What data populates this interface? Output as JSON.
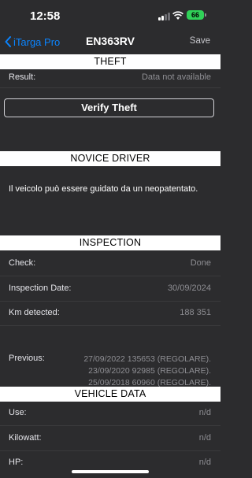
{
  "status": {
    "time": "12:58",
    "battery": "66"
  },
  "nav": {
    "back_label": "iTarga Pro",
    "title": "EN363RV",
    "save_label": "Save"
  },
  "theft": {
    "header": "THEFT",
    "result_label": "Result:",
    "result_value": "Data not available",
    "verify_button": "Verify Theft"
  },
  "novice": {
    "header": "NOVICE DRIVER",
    "text": "Il veicolo può essere guidato da un neopatentato."
  },
  "inspection": {
    "header": "INSPECTION",
    "check_label": "Check:",
    "check_value": "Done",
    "date_label": "Inspection Date:",
    "date_value": "30/09/2024",
    "km_label": "Km detected:",
    "km_value": "188 351",
    "previous_label": "Previous:",
    "previous": [
      "27/09/2022 135653 (REGOLARE).",
      "23/09/2020 92985 (REGOLARE).",
      "25/09/2018 60960 (REGOLARE)."
    ]
  },
  "vehicle": {
    "header": "VEHICLE DATA",
    "rows": [
      {
        "label": "Use:",
        "value": "n/d"
      },
      {
        "label": "Kilowatt:",
        "value": "n/d"
      },
      {
        "label": "HP:",
        "value": "n/d"
      }
    ]
  },
  "icons": {
    "back": "chevron-left-icon",
    "signal": "cellular-signal-icon",
    "wifi": "wifi-icon",
    "battery": "battery-icon"
  },
  "colors": {
    "background": "#2c2c2e",
    "accent": "#0a84ff",
    "battery": "#30d158",
    "section_header_bg": "#ffffff",
    "secondary_text": "#8e8e93"
  }
}
